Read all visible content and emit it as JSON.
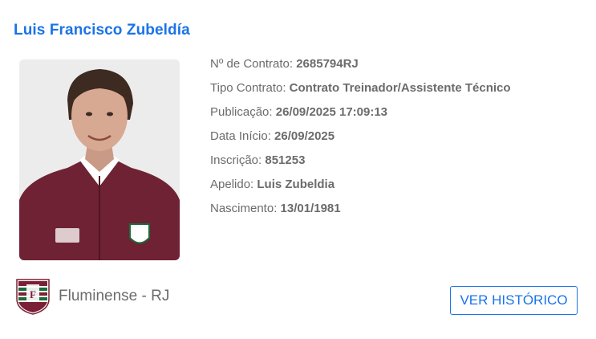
{
  "person": {
    "name": "Luis Francisco Zubeldía",
    "photo_icon": "person-portrait"
  },
  "details": [
    {
      "label": "Nº de Contrato:",
      "value": "2685794RJ"
    },
    {
      "label": "Tipo Contrato:",
      "value": "Contrato Treinador/Assistente Técnico"
    },
    {
      "label": "Publicação:",
      "value": "26/09/2025 17:09:13"
    },
    {
      "label": "Data Início:",
      "value": "26/09/2025"
    },
    {
      "label": "Inscrição:",
      "value": "851253"
    },
    {
      "label": "Apelido:",
      "value": "Luis Zubeldia"
    },
    {
      "label": "Nascimento:",
      "value": "13/01/1981"
    }
  ],
  "club": {
    "name": "Fluminense - RJ",
    "crest_icon": "club-crest-icon",
    "colors": {
      "maroon": "#7a1f35",
      "green": "#1c6b3a",
      "white": "#ffffff"
    }
  },
  "actions": {
    "history_label": "VER HISTÓRICO"
  },
  "colors": {
    "accent": "#1a73e8",
    "text_muted": "#6b6b6b"
  }
}
